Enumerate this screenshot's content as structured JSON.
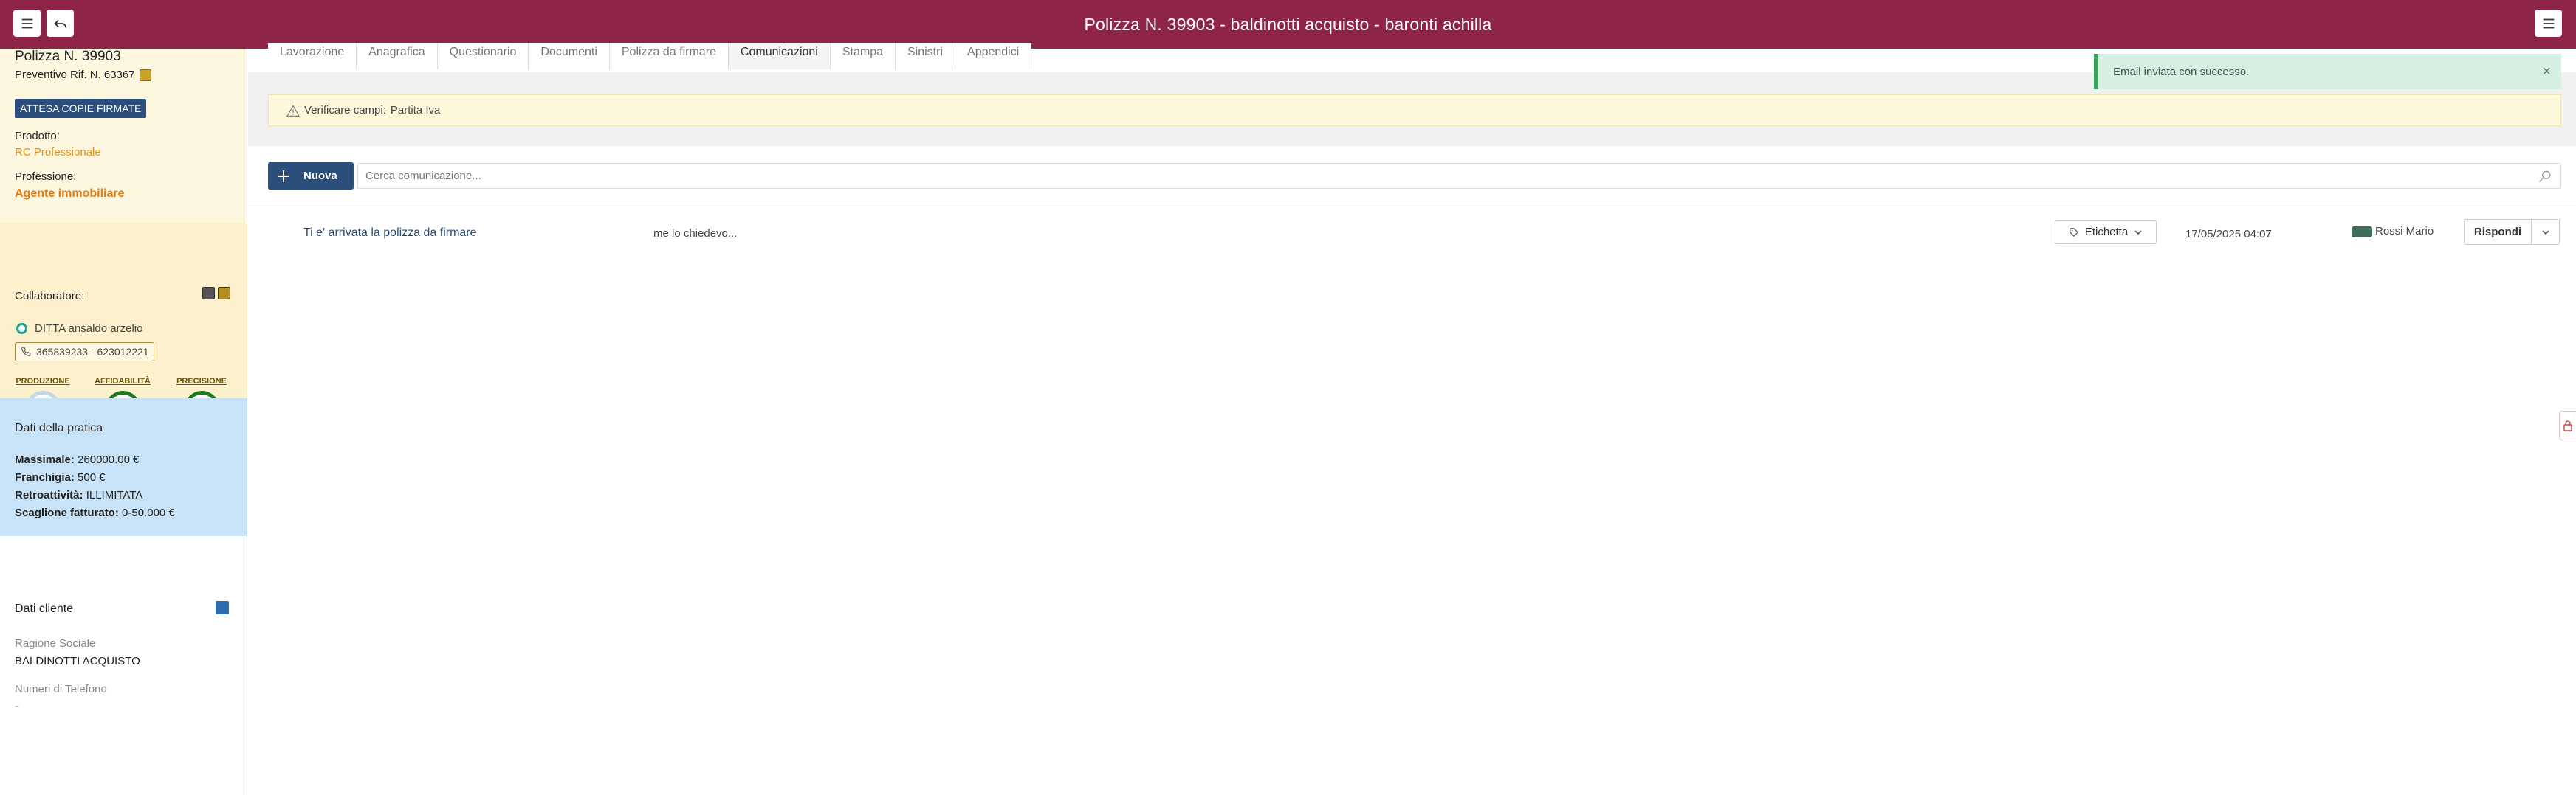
{
  "header": {
    "title": "Polizza N. 39903 - baldinotti acquisto - baronti achilla"
  },
  "sidebar": {
    "polizza": "Polizza N. 39903",
    "preventivo": "Preventivo Rif. N. 63367",
    "status": "ATTESA COPIE FIRMATE",
    "prodotto_label": "Prodotto:",
    "prodotto_value": "RC Professionale",
    "professione_label": "Professione:",
    "professione_value": "Agente immobiliare",
    "collaboratore_label": "Collaboratore:",
    "ditta": "DITTA ansaldo arzelio",
    "phone": "365839233 - 623012221",
    "kpis": [
      {
        "label": "PRODUZIONE",
        "value": "0"
      },
      {
        "label": "AFFIDABILITÀ",
        "value": "100"
      },
      {
        "label": "PRECISIONE",
        "value": "100"
      }
    ],
    "pratica_title": "Dati della pratica",
    "pratica": [
      {
        "label": "Massimale:",
        "value": "260000.00 €"
      },
      {
        "label": "Franchigia:",
        "value": "500 €"
      },
      {
        "label": "Retroattività:",
        "value": "ILLIMITATA"
      },
      {
        "label": "Scaglione fatturato:",
        "value": "0-50.000 €"
      }
    ],
    "cliente_title": "Dati cliente",
    "ragione_label": "Ragione Sociale",
    "ragione_value": "BALDINOTTI ACQUISTO",
    "telefono_label": "Numeri di Telefono",
    "telefono_value": "-"
  },
  "tabs": [
    "Lavorazione",
    "Anagrafica",
    "Questionario",
    "Documenti",
    "Polizza da firmare",
    "Comunicazioni",
    "Stampa",
    "Sinistri",
    "Appendici"
  ],
  "alert": {
    "prefix": "Verificare campi:",
    "field": "Partita Iva"
  },
  "toolbar": {
    "new_label": "Nuova",
    "search_placeholder": "Cerca comunicazione..."
  },
  "messages": [
    {
      "subject": "Ti e' arrivata la polizza da firmare",
      "preview": "me lo chiedevo...",
      "tag_label": "Etichetta",
      "date": "17/05/2025 04:07",
      "user": "Rossi Mario",
      "reply_label": "Rispondi"
    }
  ],
  "toast": {
    "message": "Email inviata con successo."
  },
  "colors": {
    "header_bg": "#8e2549",
    "primary": "#2b4f7a",
    "accent_orange": "#e59318",
    "success": "#35a35a"
  }
}
